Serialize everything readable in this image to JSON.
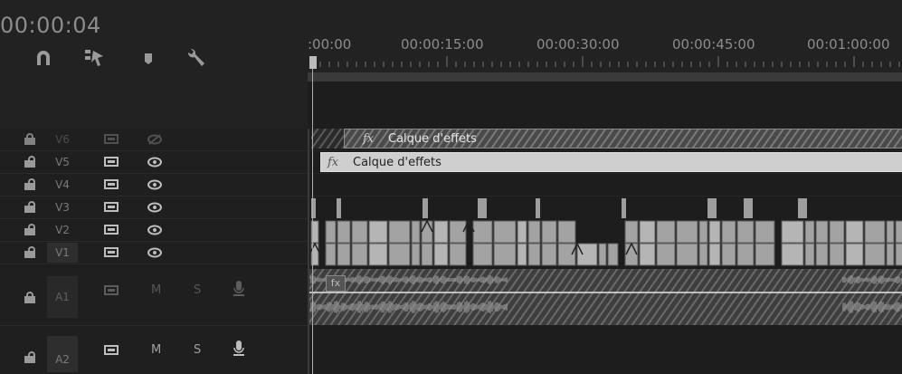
{
  "timecode": "00:00:04",
  "ruler": {
    "labels": [
      ":00:00",
      "00:00:15:00",
      "00:00:30:00",
      "00:00:45:00",
      "00:01:00:00"
    ]
  },
  "tools": [
    {
      "name": "snap",
      "icon": "magnet-icon"
    },
    {
      "name": "linked-selection",
      "icon": "linked-selection-icon"
    },
    {
      "name": "add-marker",
      "icon": "marker-icon"
    },
    {
      "name": "timeline-settings",
      "icon": "wrench-icon"
    }
  ],
  "video_tracks": [
    {
      "name": "V6",
      "locked": true
    },
    {
      "name": "V5",
      "locked": false
    },
    {
      "name": "V4",
      "locked": false
    },
    {
      "name": "V3",
      "locked": false
    },
    {
      "name": "V2",
      "locked": false
    },
    {
      "name": "V1",
      "locked": false
    }
  ],
  "audio_tracks": [
    {
      "name": "A1",
      "mute": "M",
      "solo": "S",
      "locked": true
    },
    {
      "name": "A2",
      "mute": "M",
      "solo": "S",
      "locked": false
    }
  ],
  "clips": {
    "adjustment_label": "Calque d'effets",
    "fx_label": "fx"
  },
  "colors": {
    "clip": "#a8a8a8",
    "adjustment": "#cfcfcf",
    "panel": "#222222"
  }
}
